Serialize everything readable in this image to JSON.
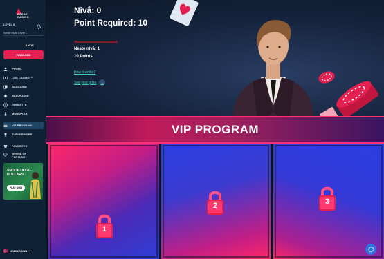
{
  "brand": {
    "logo_line1": "BEEBE",
    "logo_line2": "CASINO",
    "accent": "#e3204f"
  },
  "sidebar": {
    "level_label": "LEVEL 0",
    "next_level": "Neste nivå: Level 1",
    "progress": 0.0,
    "balance": "0 NOK",
    "deposit_label": "INNSKUDD",
    "items": [
      {
        "label": "PROFIL",
        "icon": "user-icon"
      },
      {
        "label": "LIVE CASINO",
        "icon": "live-icon",
        "caret": "^"
      },
      {
        "label": "BACCARAT",
        "icon": "cards-icon"
      },
      {
        "label": "BLACKJACK",
        "icon": "spade-icon"
      },
      {
        "label": "ROULETTE",
        "icon": "roulette-icon"
      },
      {
        "label": "MONOPOLY",
        "icon": "monopoly-icon"
      },
      {
        "label": "VIP-PROGRAM",
        "icon": "crown-icon"
      },
      {
        "label": "TURNERINGER",
        "icon": "trophy-icon"
      },
      {
        "label": "FAVORITES",
        "icon": "heart-icon"
      },
      {
        "label": "WHEEL OF FORTUNE",
        "icon": "tag-icon"
      }
    ],
    "promo": {
      "title": "SNOOP DOGG DOLLARS",
      "button": "PLAY NOW"
    },
    "language": "NORWEGIAN",
    "language_caret": "^"
  },
  "hero": {
    "level_title": "Nivå: 0",
    "points_required": "Point Required: 10",
    "progress": 0.0,
    "next_level": "Neste nivå: 1",
    "points": "10 Points",
    "how_link": "How it works?",
    "prize_link": "See your prize",
    "prize_arrow": "→"
  },
  "banner": {
    "title": "VIP PROGRAM"
  },
  "tiers": [
    {
      "number": "1"
    },
    {
      "number": "2"
    },
    {
      "number": "3"
    }
  ]
}
